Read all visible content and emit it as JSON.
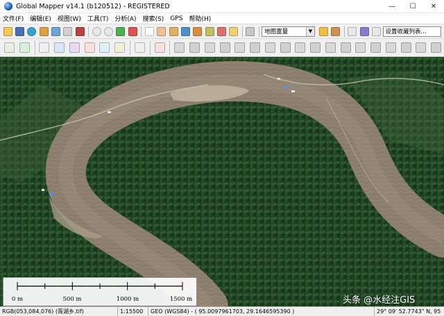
{
  "window": {
    "title": "Global Mapper v14.1 (b120512) - REGISTERED",
    "minimize": "—",
    "maximize": "☐",
    "close": "✕"
  },
  "menu": [
    "文件(F)",
    "编辑(E)",
    "视图(W)",
    "工具(T)",
    "分析(A)",
    "搜索(S)",
    "GPS",
    "帮助(H)"
  ],
  "toolbar1": {
    "layer_combo": "地图富量",
    "layer_list": "设置收藏列表..."
  },
  "statusbar": {
    "pixel": "RGB(053,084,076) (胥湖乡.tif)",
    "scale": "1:15500",
    "projection": "GEO (WGS84) - ( 95.0097961703, 29.1646595390 )",
    "coords": "29° 09' 52.7743\" N, 95"
  },
  "scale": {
    "labels": [
      "0 m",
      "500 m",
      "1000 m",
      "1500 m"
    ]
  },
  "watermark": "头条 @水经注GIS",
  "colors": {
    "forest": "#1e3d22",
    "river": "#8a7d6c",
    "sandbar": "#b9ac96"
  }
}
